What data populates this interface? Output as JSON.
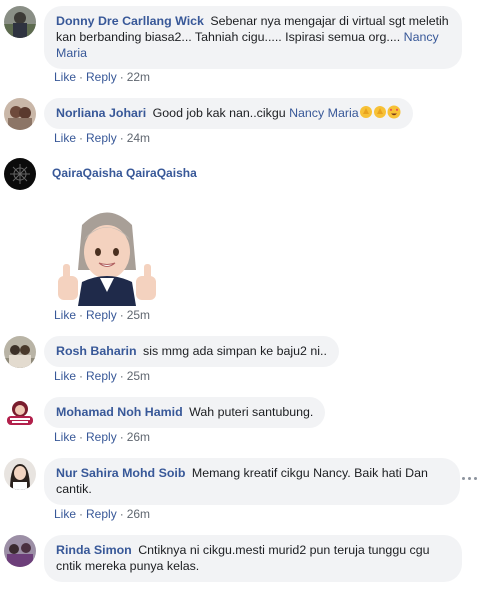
{
  "comments": [
    {
      "name": "Donny Dre Carllang Wick",
      "text": "Sebenar nya mengajar di virtual sgt meletih kan berbanding biasa2... Tahniah cigu..... Ispirasi semua org....",
      "tag": "Nancy Maria",
      "like": "Like",
      "reply": "Reply",
      "time": "22m"
    },
    {
      "name": "Norliana Johari",
      "text": "Good job kak nan..cikgu",
      "tag": "Nancy Maria",
      "emojis": [
        "clapping-hands-emoji",
        "clapping-hands-emoji",
        "star-struck-emoji"
      ],
      "like": "Like",
      "reply": "Reply",
      "time": "24m"
    },
    {
      "name": "QairaQaisha QairaQaisha",
      "sticker": "thumbs-up-avatar-sticker",
      "like": "Like",
      "reply": "Reply",
      "time": "25m"
    },
    {
      "name": "Rosh Baharin",
      "text": "sis mmg ada simpan ke baju2 ni..",
      "like": "Like",
      "reply": "Reply",
      "time": "25m"
    },
    {
      "name": "Mohamad Noh Hamid",
      "text": "Wah puteri santubung.",
      "like": "Like",
      "reply": "Reply",
      "time": "26m"
    },
    {
      "name": "Nur Sahira Mohd Soib",
      "text": "Memang kreatif cikgu Nancy. Baik hati Dan cantik.",
      "like": "Like",
      "reply": "Reply",
      "time": "26m"
    },
    {
      "name": "Rinda Simon",
      "text": "Cntiknya ni cikgu.mesti murid2 pun teruja tunggu cgu cntik mereka punya kelas."
    }
  ],
  "colors": {
    "link": "#385898",
    "bubble": "#f2f3f5",
    "meta": "#606770"
  }
}
